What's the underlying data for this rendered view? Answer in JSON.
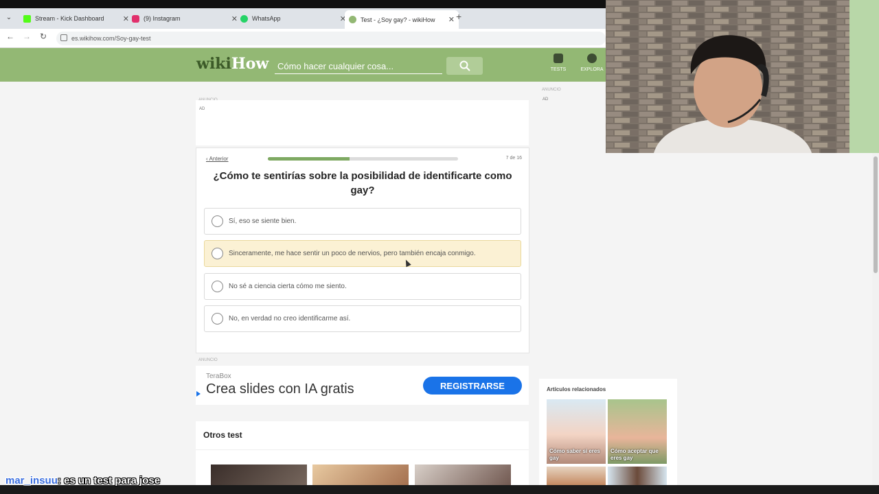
{
  "browser": {
    "tabs": [
      {
        "label": "Stream - Kick Dashboard",
        "icon": "kick-icon",
        "color": "#53fc18"
      },
      {
        "label": "(9) Instagram",
        "icon": "instagram-icon",
        "color": "#e1306c"
      },
      {
        "label": "WhatsApp",
        "icon": "whatsapp-icon",
        "color": "#25d366"
      },
      {
        "label": "Test - ¿Soy gay? - wikiHow",
        "icon": "wikihow-icon",
        "color": "#93b874"
      }
    ],
    "url": "es.wikihow.com/Soy-gay-test"
  },
  "header": {
    "logo_part1": "wiki",
    "logo_part2": "How",
    "search_placeholder": "Cómo hacer cualquier cosa...",
    "nav": [
      {
        "label": "TESTS",
        "icon": "tests-icon"
      },
      {
        "label": "EXPLORA",
        "icon": "compass-icon"
      }
    ]
  },
  "ads": {
    "label_small": "ANUNCIO",
    "label_ad": "AD",
    "banner": {
      "brand": "TeraBox",
      "text": "Crea slides con IA gratis",
      "button": "REGISTRARSE"
    }
  },
  "quiz": {
    "back_label": "‹ Anterior",
    "progress_fraction": 0.43,
    "counter": "7 de 16",
    "question": "¿Cómo te sentirías sobre la posibilidad de identificarte como gay?",
    "options": [
      "Sí, eso se siente bien.",
      "Sinceramente, me hace sentir un poco de nervios, pero también encaja conmigo.",
      "No sé a ciencia cierta cómo me siento.",
      "No, en verdad no creo identificarme así."
    ],
    "hovered_option_index": 1
  },
  "others": {
    "title": "Otros test"
  },
  "related": {
    "title": "Artículos relacionados",
    "items": [
      {
        "label": "Cómo saber si eres gay"
      },
      {
        "label": "Cómo aceptar que eres gay"
      }
    ]
  },
  "chat": {
    "user": "mar_insuu",
    "message": ": es un test para jose"
  },
  "colors": {
    "brand_green": "#93b874",
    "progress": "#7ea962",
    "hover": "#fbf1d4",
    "cta": "#1a73e8"
  }
}
